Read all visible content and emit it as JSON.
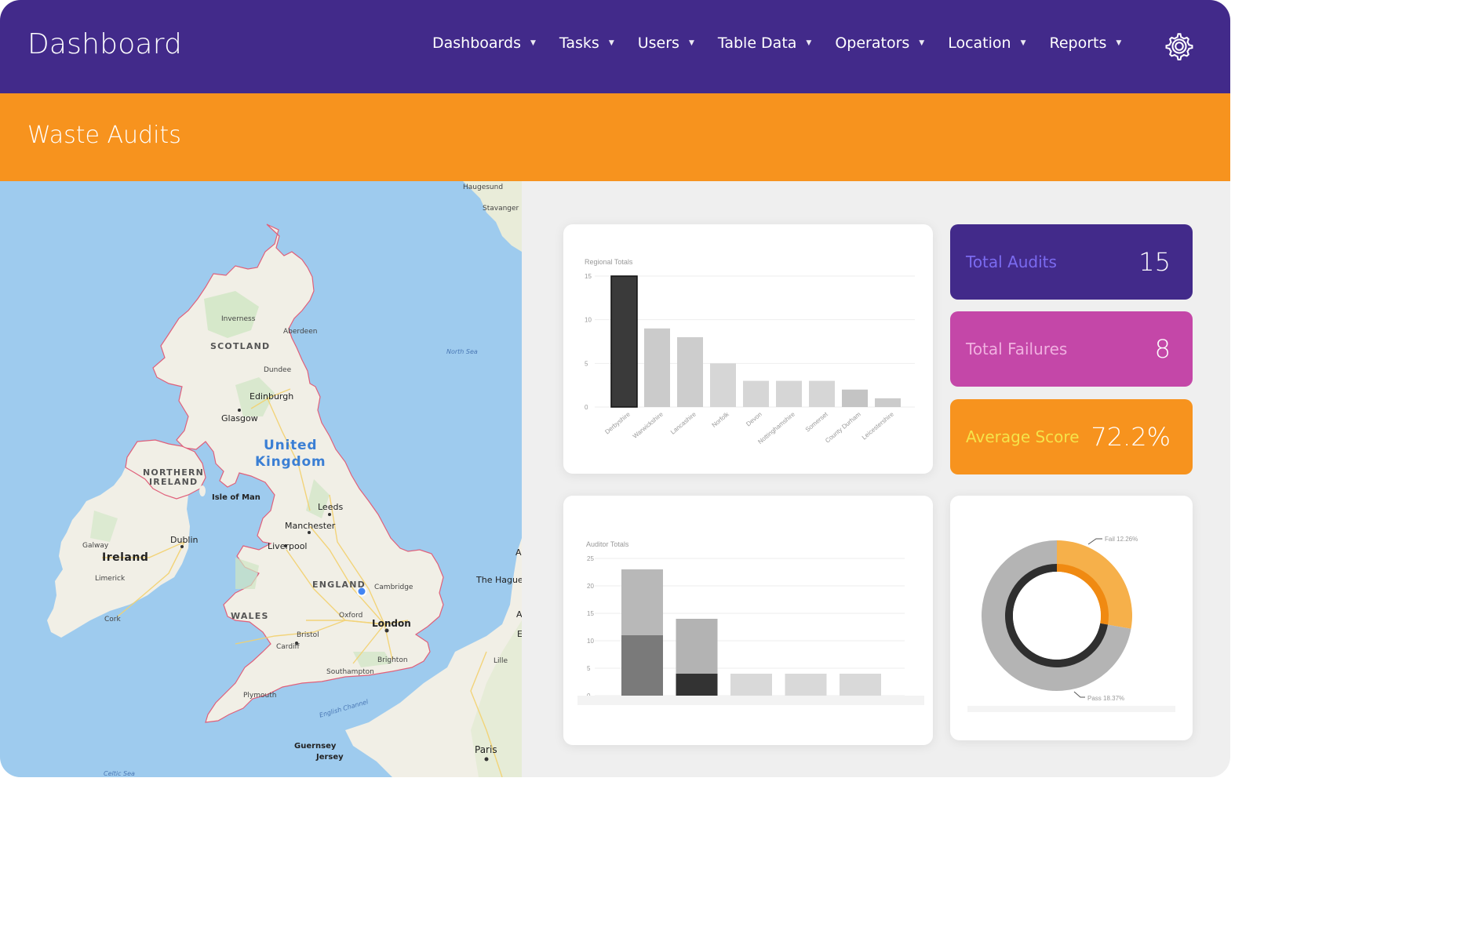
{
  "app": {
    "title": "Dashboard"
  },
  "nav": {
    "items": [
      {
        "label": "Dashboards",
        "name": "nav-dashboards"
      },
      {
        "label": "Tasks",
        "name": "nav-tasks"
      },
      {
        "label": "Users",
        "name": "nav-users"
      },
      {
        "label": "Table Data",
        "name": "nav-table-data"
      },
      {
        "label": "Operators",
        "name": "nav-operators"
      },
      {
        "label": "Location",
        "name": "nav-location"
      },
      {
        "label": "Reports",
        "name": "nav-reports"
      }
    ],
    "caret_glyph": "▼",
    "settings_icon": "gear-icon"
  },
  "page": {
    "title": "Waste Audits"
  },
  "map": {
    "labels": {
      "haugesund": "Haugesund",
      "stavanger": "Stavanger",
      "inverness": "Inverness",
      "aberdeen": "Aberdeen",
      "scotland": "SCOTLAND",
      "dundee": "Dundee",
      "north_sea": "North Sea",
      "edinburgh": "Edinburgh",
      "glasgow": "Glasgow",
      "united": "United",
      "kingdom": "Kingdom",
      "northern": "NORTHERN",
      "ireland_ni": "IRELAND",
      "isle_of_man": "Isle of Man",
      "leeds": "Leeds",
      "manchester": "Manchester",
      "liverpool": "Liverpool",
      "dublin": "Dublin",
      "galway": "Galway",
      "ireland": "Ireland",
      "limerick": "Limerick",
      "england": "ENGLAND",
      "cambridge": "Cambridge",
      "the_hague": "The Hague",
      "cork": "Cork",
      "wales": "WALES",
      "oxford": "Oxford",
      "london": "London",
      "bristol": "Bristol",
      "cardiff": "Cardiff",
      "brighton": "Brighton",
      "southampton": "Southampton",
      "plymouth": "Plymouth",
      "english_channel": "English Channel",
      "guernsey": "Guernsey",
      "jersey": "Jersey",
      "paris": "Paris",
      "celtic_sea": "Celtic Sea",
      "lille": "Lille",
      "edge_a": "A",
      "edge_a2": "A",
      "edge_e": "E"
    },
    "colors": {
      "sea": "#9ecbee",
      "land": "#f1efe6",
      "green": "#cfe6c3",
      "border": "#e0607a",
      "road": "#f3d16e"
    }
  },
  "stats": {
    "total_audits": {
      "label": "Total Audits",
      "value": "15",
      "bg": "#422a8a",
      "label_color": "#7b6bf0"
    },
    "total_failures": {
      "label": "Total Failures",
      "value": "8",
      "bg": "#c447a8",
      "label_color": "#f0b0e0"
    },
    "average_score": {
      "label": "Average Score",
      "value": "72.2%",
      "bg": "#f7931e",
      "label_color": "#f5e34a"
    }
  },
  "chart_data": [
    {
      "type": "bar",
      "title": "Regional Totals",
      "categories": [
        "Derbyshire",
        "Warwickshire",
        "Lancashire",
        "Norfolk",
        "Devon",
        "Nottinghamshire",
        "Somerset",
        "County Durham",
        "Leicestershire"
      ],
      "values": [
        15,
        9,
        8,
        5,
        3,
        3,
        3,
        2,
        1
      ],
      "ylim": [
        0,
        15
      ],
      "yticks": [
        0,
        5,
        10,
        15
      ],
      "colors": [
        "#3a3a3a",
        "#cbcbcb",
        "#cdcdcd",
        "#d6d6d6",
        "#d6d6d6",
        "#d6d6d6",
        "#d6d6d6",
        "#c4c4c4",
        "#cbcbcb"
      ]
    },
    {
      "type": "bar",
      "title": "Auditor Totals",
      "stacked": true,
      "categories": [
        "",
        "",
        "",
        "",
        ""
      ],
      "series": [
        {
          "values": [
            11,
            4,
            0,
            0,
            0
          ],
          "colors": [
            "#7a7a7a",
            "#333333",
            "#dcdcdc",
            "#dcdcdc",
            "#dcdcdc"
          ]
        },
        {
          "values": [
            12,
            10,
            4,
            4,
            4
          ],
          "colors": [
            "#b8b8b8",
            "#b3b3b3",
            "#d9d9d9",
            "#d9d9d9",
            "#d9d9d9"
          ]
        }
      ],
      "ylim": [
        0,
        25
      ],
      "yticks": [
        0,
        5,
        10,
        15,
        20,
        25
      ]
    },
    {
      "type": "pie",
      "title": "",
      "slices": [
        {
          "label": "Fail 12.26%",
          "value": 27.8,
          "color": "#f6b04a"
        },
        {
          "label": "Pass 18.37%",
          "value": 72.2,
          "color": "#b4b4b4"
        }
      ]
    }
  ]
}
